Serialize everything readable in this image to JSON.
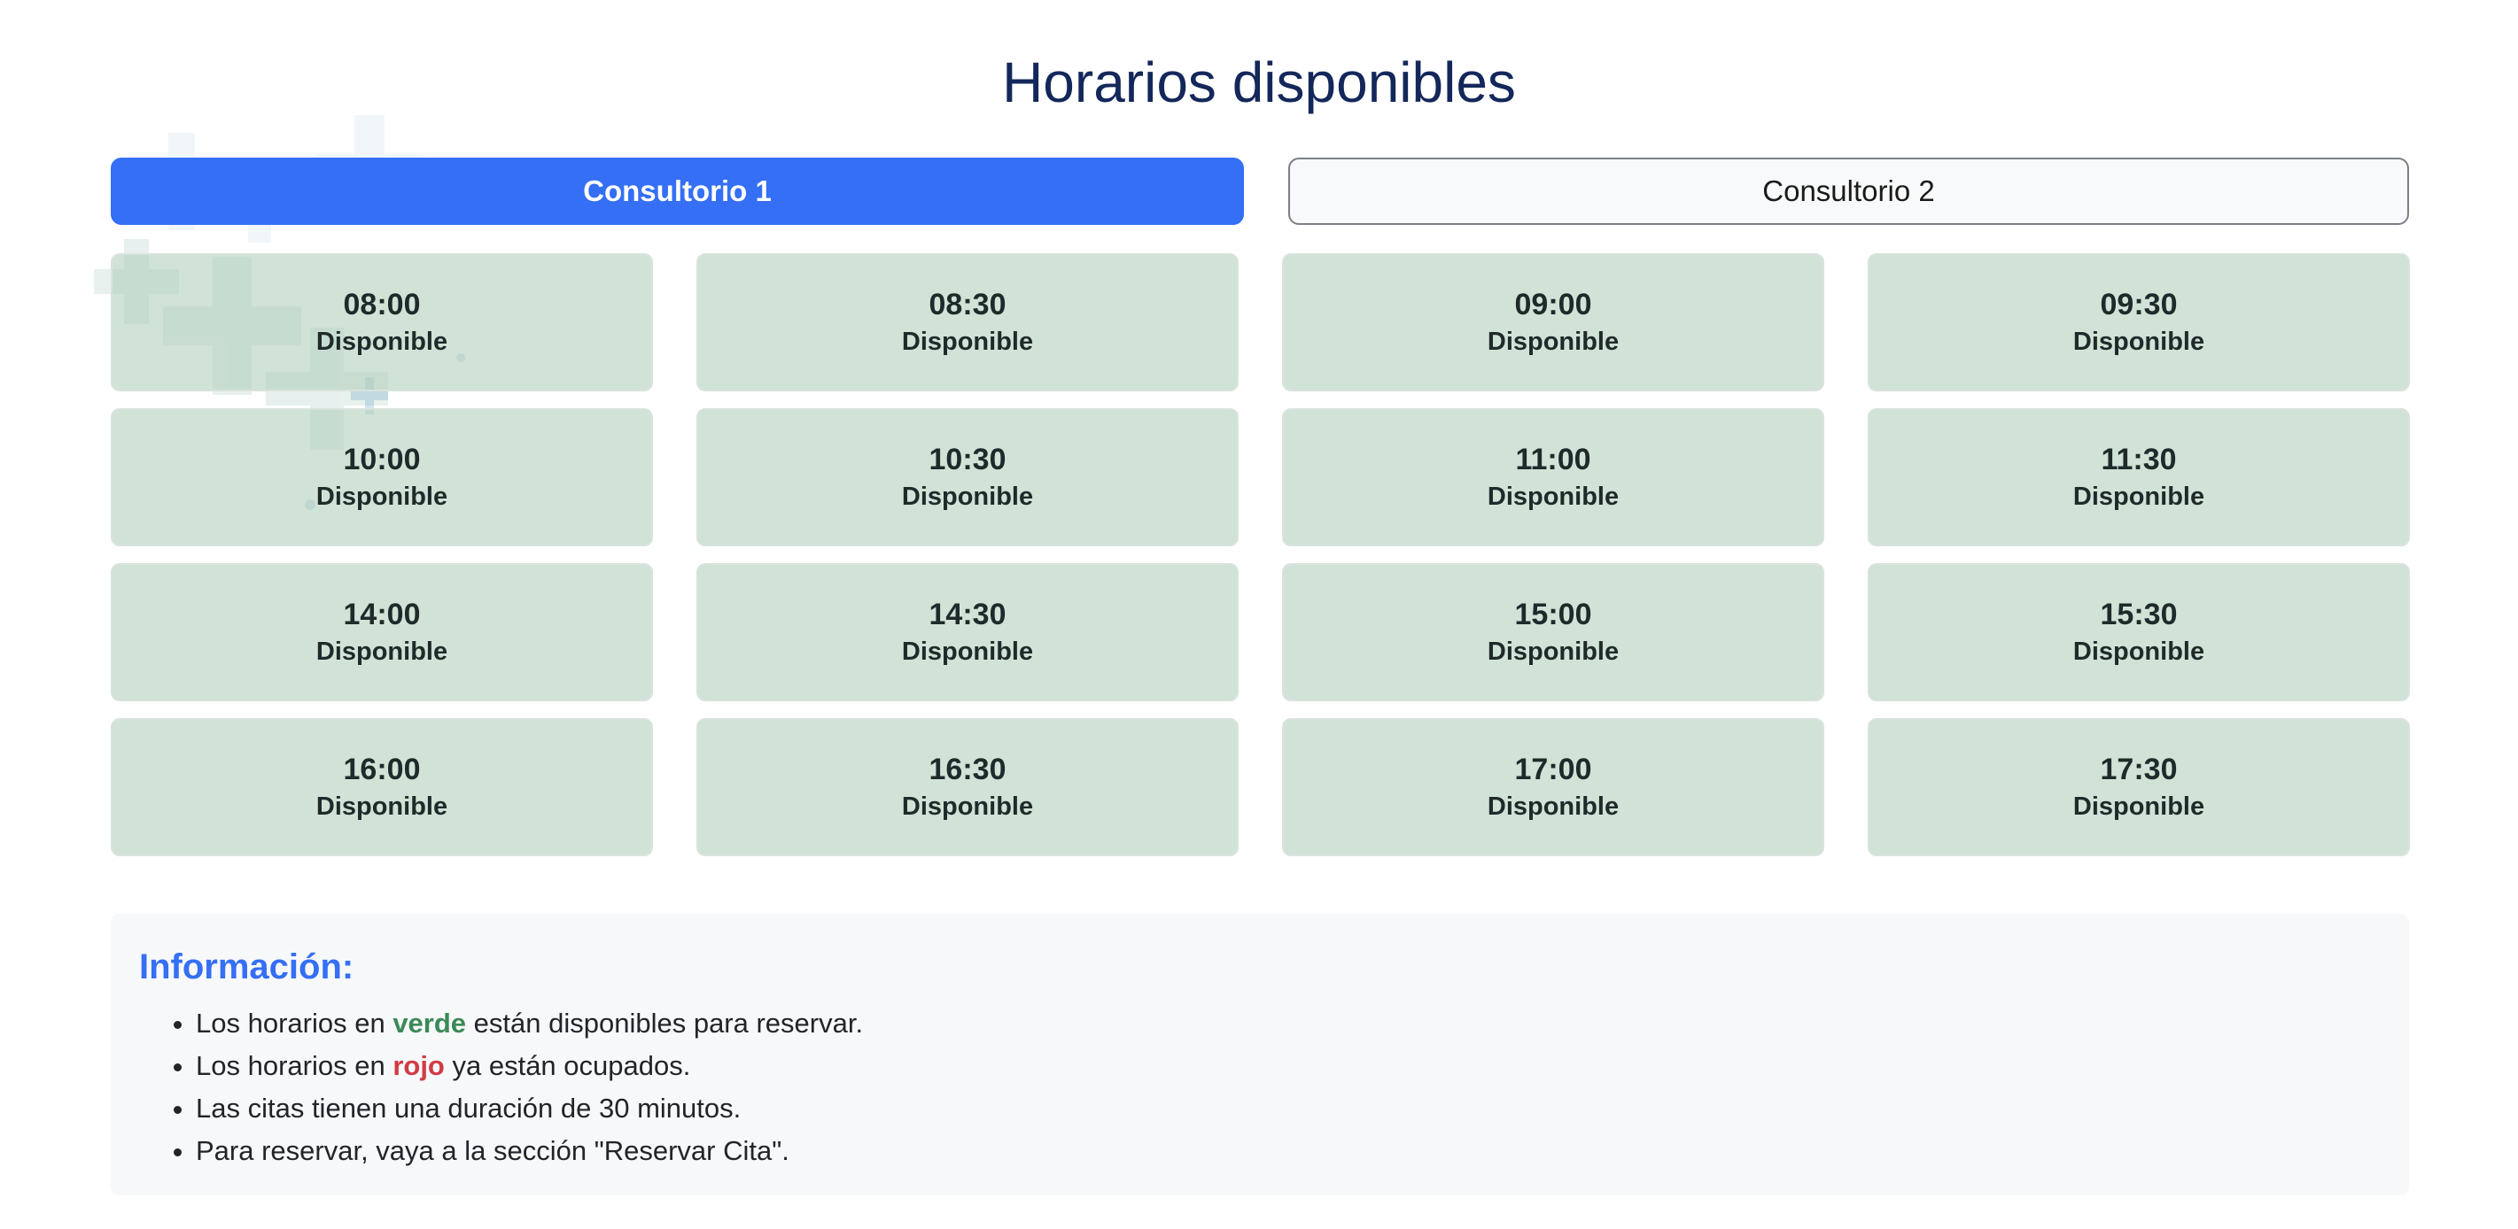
{
  "page": {
    "title": "Horarios disponibles"
  },
  "tabs": [
    {
      "label": "Consultorio 1",
      "active": true
    },
    {
      "label": "Consultorio 2",
      "active": false
    }
  ],
  "colors": {
    "accent": "#346ff5",
    "title": "#13275a",
    "available_bg": "#cfe1d6",
    "verde": "#3a8a57",
    "rojo": "#d13b45"
  },
  "slots": [
    {
      "time": "08:00",
      "status": "Disponible"
    },
    {
      "time": "08:30",
      "status": "Disponible"
    },
    {
      "time": "09:00",
      "status": "Disponible"
    },
    {
      "time": "09:30",
      "status": "Disponible"
    },
    {
      "time": "10:00",
      "status": "Disponible"
    },
    {
      "time": "10:30",
      "status": "Disponible"
    },
    {
      "time": "11:00",
      "status": "Disponible"
    },
    {
      "time": "11:30",
      "status": "Disponible"
    },
    {
      "time": "14:00",
      "status": "Disponible"
    },
    {
      "time": "14:30",
      "status": "Disponible"
    },
    {
      "time": "15:00",
      "status": "Disponible"
    },
    {
      "time": "15:30",
      "status": "Disponible"
    },
    {
      "time": "16:00",
      "status": "Disponible"
    },
    {
      "time": "16:30",
      "status": "Disponible"
    },
    {
      "time": "17:00",
      "status": "Disponible"
    },
    {
      "time": "17:30",
      "status": "Disponible"
    }
  ],
  "info": {
    "title": "Información:",
    "items": [
      {
        "pre": "Los horarios en ",
        "highlight": "verde",
        "post": " están disponibles para reservar."
      },
      {
        "pre": "Los horarios en ",
        "highlight": "rojo",
        "post": " ya están ocupados."
      },
      {
        "text": "Las citas tienen una duración de 30 minutos."
      },
      {
        "text": "Para reservar, vaya a la sección \"Reservar Cita\"."
      }
    ]
  },
  "decoration": {
    "icon": "medical-cross-pattern-icon"
  }
}
